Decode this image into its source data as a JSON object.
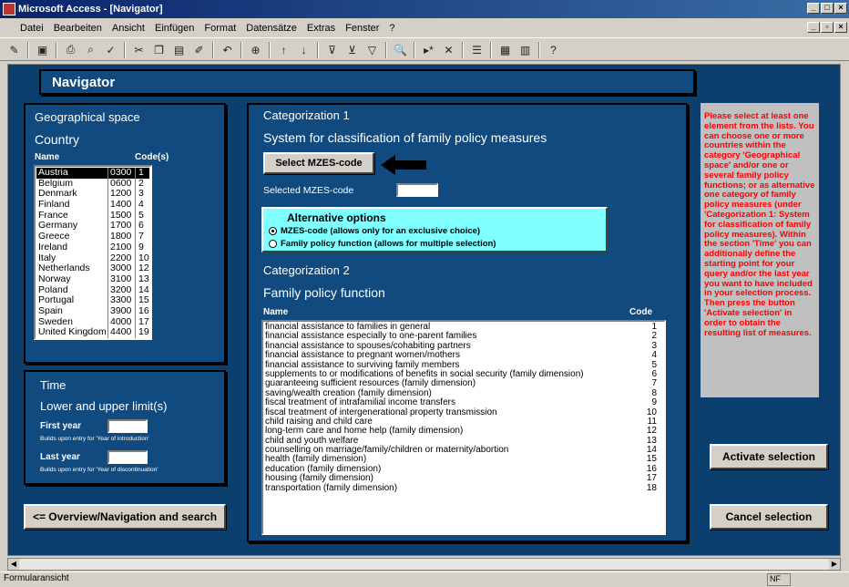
{
  "window": {
    "title": "Microsoft Access - [Navigator]"
  },
  "menu": [
    "Datei",
    "Bearbeiten",
    "Ansicht",
    "Einfügen",
    "Format",
    "Datensätze",
    "Extras",
    "Fenster",
    "?"
  ],
  "form": {
    "title": "Navigator",
    "geo": {
      "heading": "Geographical space",
      "sub": "Country",
      "col_name": "Name",
      "col_code": "Code(s)",
      "rows": [
        [
          "Austria",
          "0300",
          "1"
        ],
        [
          "Belgium",
          "0600",
          "2"
        ],
        [
          "Denmark",
          "1200",
          "3"
        ],
        [
          "Finland",
          "1400",
          "4"
        ],
        [
          "France",
          "1500",
          "5"
        ],
        [
          "Germany",
          "1700",
          "6"
        ],
        [
          "Greece",
          "1800",
          "7"
        ],
        [
          "Ireland",
          "2100",
          "9"
        ],
        [
          "Italy",
          "2200",
          "10"
        ],
        [
          "Netherlands",
          "3000",
          "12"
        ],
        [
          "Norway",
          "3100",
          "13"
        ],
        [
          "Poland",
          "3200",
          "14"
        ],
        [
          "Portugal",
          "3300",
          "15"
        ],
        [
          "Spain",
          "3900",
          "16"
        ],
        [
          "Sweden",
          "4000",
          "17"
        ],
        [
          "United Kingdom",
          "4400",
          "19"
        ]
      ]
    },
    "time": {
      "heading": "Time",
      "sub": "Lower and upper limit(s)",
      "first_label": "First year",
      "first_note": "Builds upon entry for 'Year of introduction'",
      "last_label": "Last year",
      "last_note": "Builds upon entry for 'Year of discontinuation'"
    },
    "nav_button": "<= Overview/Navigation and search",
    "cat1": {
      "heading": "Categorization 1",
      "sub": "System for classification of family policy measures",
      "select_button": "Select MZES-code",
      "selected_label": "Selected MZES-code"
    },
    "alt": {
      "heading": "Alternative options",
      "opt1": "MZES-code (allows only for an exclusive choice)",
      "opt2": "Family policy function (allows for multiple selection)"
    },
    "cat2": {
      "heading": "Categorization 2",
      "sub": "Family policy function",
      "col_name": "Name",
      "col_code": "Code",
      "rows": [
        [
          "financial assistance to families in general",
          "1"
        ],
        [
          "financial assistance especially to one-parent families",
          "2"
        ],
        [
          "financial assistance to spouses/cohabiting partners",
          "3"
        ],
        [
          "financial assistance to pregnant women/mothers",
          "4"
        ],
        [
          "financial assistance to surviving family members",
          "5"
        ],
        [
          "supplements to or modifications of benefits in social security (family dimension)",
          "6"
        ],
        [
          "guaranteeing sufficient resources (family dimension)",
          "7"
        ],
        [
          "saving/wealth creation (family dimension)",
          "8"
        ],
        [
          "fiscal treatment of intrafamilial income transfers",
          "9"
        ],
        [
          "fiscal treatment of intergenerational property transmission",
          "10"
        ],
        [
          "child raising and child care",
          "11"
        ],
        [
          "long-term care and home help (family dimension)",
          "12"
        ],
        [
          "child and youth welfare",
          "13"
        ],
        [
          "counselling on marriage/family/children or maternity/abortion",
          "14"
        ],
        [
          "health (family dimension)",
          "15"
        ],
        [
          "education (family dimension)",
          "16"
        ],
        [
          "housing (family dimension)",
          "17"
        ],
        [
          "transportation (family dimension)",
          "18"
        ]
      ]
    },
    "help": "Please select at least one element from the lists. You can choose one or more countries within the category 'Geographical space' and/or one or several family policy functions; or as alternative one category of family policy measures (under 'Categorization 1: System for classification of family policy measures). Within the section 'Time' you can additionally define the starting point for your query and/or the last year you want to have included in your selection process. Then press the button 'Activate selection' in order to obtain the resulting list of measures.",
    "activate": "Activate selection",
    "cancel": "Cancel selection"
  },
  "status": {
    "left": "Formularansicht",
    "nf": "NF"
  },
  "colors": {
    "background": "#0a3f6e",
    "help_text": "#ff0000",
    "alt_box": "#7fffff"
  }
}
